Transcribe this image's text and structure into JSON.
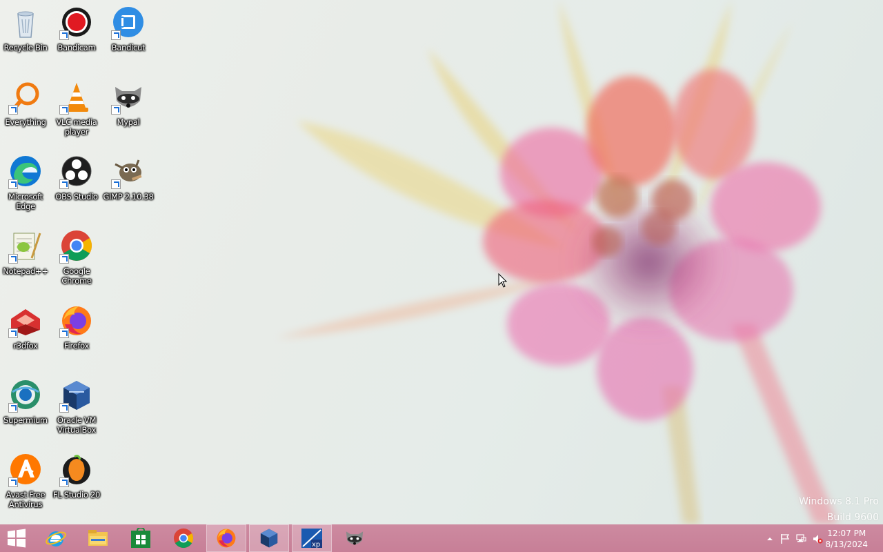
{
  "desktop_icons": [
    {
      "label": "Recycle Bin",
      "icon": "recycle-bin-icon"
    },
    {
      "label": "Bandicam",
      "icon": "bandicam-icon"
    },
    {
      "label": "Bandicut",
      "icon": "bandicut-icon"
    },
    {
      "label": "Everything",
      "icon": "everything-search-icon"
    },
    {
      "label": "VLC media player",
      "icon": "vlc-cone-icon"
    },
    {
      "label": "Mypal",
      "icon": "mypal-raccoon-icon"
    },
    {
      "label": "Microsoft Edge",
      "icon": "edge-icon"
    },
    {
      "label": "OBS Studio",
      "icon": "obs-icon"
    },
    {
      "label": "GIMP 2.10.38",
      "icon": "gimp-icon"
    },
    {
      "label": "Notepad++",
      "icon": "notepad-plus-plus-icon"
    },
    {
      "label": "Google Chrome",
      "icon": "chrome-icon"
    },
    {
      "label": "r3dfox",
      "icon": "r3dfox-icon"
    },
    {
      "label": "Firefox",
      "icon": "firefox-icon"
    },
    {
      "label": "Supermium",
      "icon": "supermium-icon"
    },
    {
      "label": "Oracle VM VirtualBox",
      "icon": "virtualbox-icon"
    },
    {
      "label": "Avast Free Antivirus",
      "icon": "avast-icon"
    },
    {
      "label": "FL Studio 20",
      "icon": "fl-studio-icon"
    }
  ],
  "watermark": {
    "line1": "Windows 8.1 Pro",
    "line2": "Build 9600"
  },
  "taskbar": {
    "start": "windows-start-icon",
    "pinned": [
      {
        "name": "internet-explorer-icon",
        "active": false
      },
      {
        "name": "file-explorer-icon",
        "active": false
      },
      {
        "name": "windows-store-icon",
        "active": false
      },
      {
        "name": "chrome-icon",
        "active": false
      },
      {
        "name": "firefox-icon",
        "active": true
      },
      {
        "name": "virtualbox-icon",
        "active": true
      },
      {
        "name": "virtualbox-xp-vm-icon",
        "active": true
      },
      {
        "name": "mypal-raccoon-icon",
        "active": false
      }
    ]
  },
  "tray": {
    "time": "12:07 PM",
    "date": "8/13/2024"
  },
  "colors": {
    "taskbar": "#c9849b",
    "petal_pink": "#e870a8",
    "petal_coral": "#f07a6a",
    "leaf_yellow": "#e8d98a"
  }
}
